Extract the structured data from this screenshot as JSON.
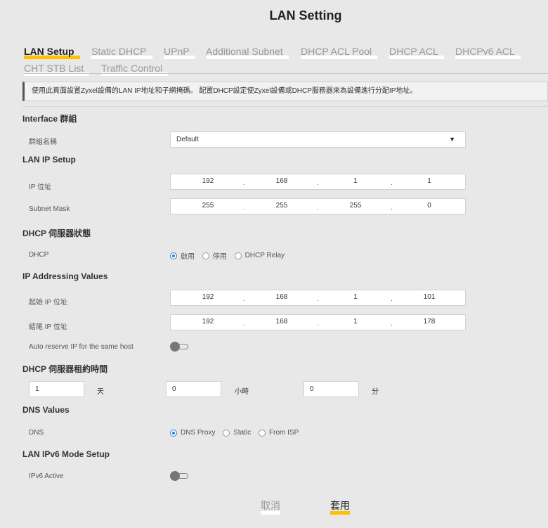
{
  "page": {
    "title": "LAN Setting"
  },
  "tabs": [
    {
      "label": "LAN Setup",
      "active": true
    },
    {
      "label": "Static DHCP"
    },
    {
      "label": "UPnP"
    },
    {
      "label": "Additional Subnet"
    },
    {
      "label": "DHCP ACL Pool"
    },
    {
      "label": "DHCP ACL"
    },
    {
      "label": "DHCPv6 ACL"
    },
    {
      "label": "CHT STB List"
    },
    {
      "label": "Traffic Control"
    }
  ],
  "notice": "使用此頁面設置Zyxel設備的LAN IP地址和子網掩碼。 配置DHCP設定使Zyxel設備或DHCP服務器來為設備進行分配IP地址。",
  "interface_group": {
    "heading": "Interface 群組",
    "group_name_label": "群組名稱",
    "group_name_value": "Default"
  },
  "lan_ip": {
    "heading": "LAN IP Setup",
    "ip_label": "IP 位址",
    "ip": [
      "192",
      "168",
      "1",
      "1"
    ],
    "mask_label": "Subnet Mask",
    "mask": [
      "255",
      "255",
      "255",
      "0"
    ]
  },
  "dhcp_server": {
    "heading": "DHCP 伺服器狀態",
    "label": "DHCP",
    "options": [
      "啟用",
      "停用",
      "DHCP Relay"
    ],
    "selected": "啟用"
  },
  "ip_addressing": {
    "heading": "IP Addressing Values",
    "start_label": "起始 IP 位址",
    "start": [
      "192",
      "168",
      "1",
      "101"
    ],
    "end_label": "結尾 IP 位址",
    "end": [
      "192",
      "168",
      "1",
      "178"
    ],
    "auto_reserve_label": "Auto reserve IP for the same host",
    "auto_reserve_on": false
  },
  "lease": {
    "heading": "DHCP 伺服器租約時間",
    "days": "1",
    "days_unit": "天",
    "hours": "0",
    "hours_unit": "小時",
    "minutes": "0",
    "minutes_unit": "分"
  },
  "dns": {
    "heading": "DNS Values",
    "label": "DNS",
    "options": [
      "DNS Proxy",
      "Static",
      "From ISP"
    ],
    "selected": "DNS Proxy"
  },
  "ipv6": {
    "heading": "LAN IPv6 Mode Setup",
    "label": "IPv6 Active",
    "active": false
  },
  "buttons": {
    "cancel": "取消",
    "apply": "套用"
  },
  "colors": {
    "accent": "#ffc000",
    "radio": "#2a7fd4",
    "background": "#e8e8e8"
  }
}
